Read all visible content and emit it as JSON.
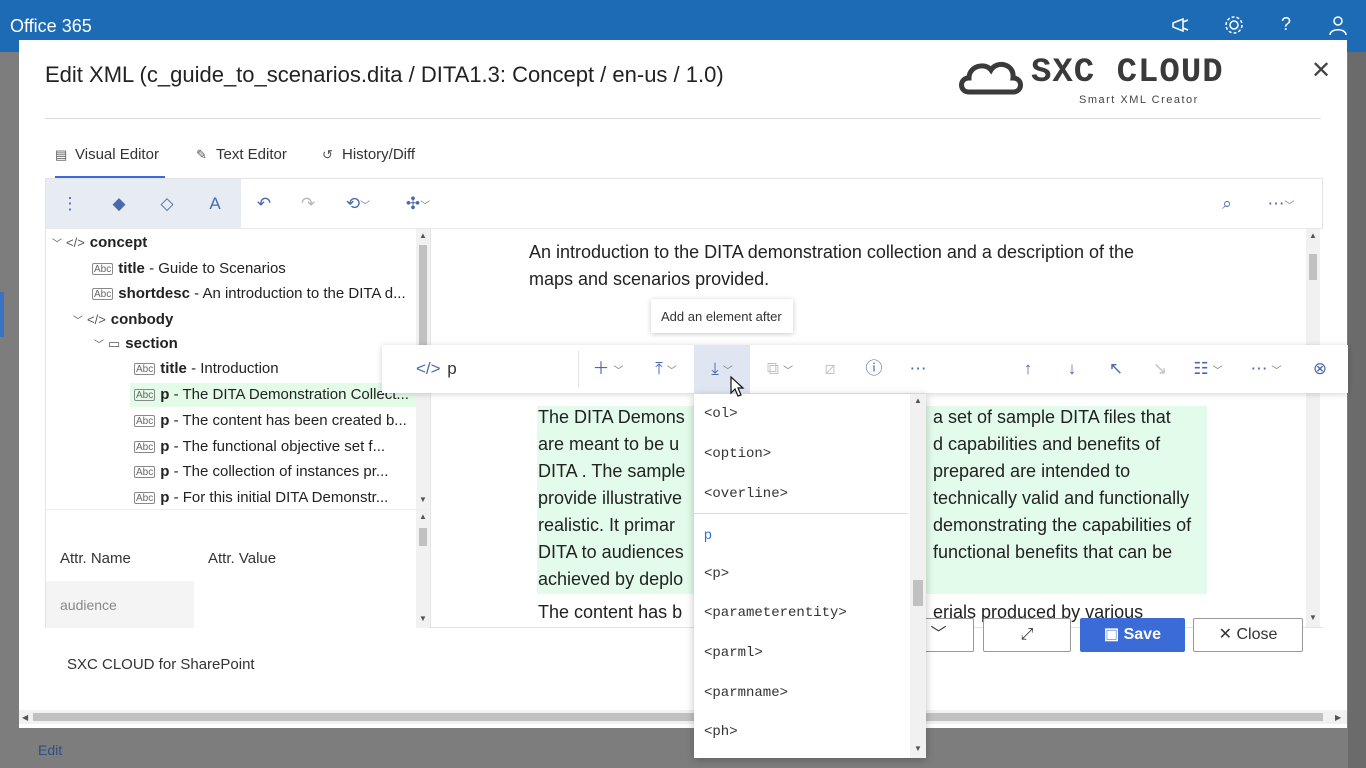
{
  "topbar": {
    "brand": "Office 365",
    "icons": [
      "megaphone-icon",
      "gear-icon",
      "help-icon",
      "person-icon"
    ]
  },
  "background": {
    "edit_link": "Edit"
  },
  "modal": {
    "title": "Edit XML (c_guide_to_scenarios.dita / DITA1.3: Concept / en-us / 1.0)",
    "logo_word": "SXC CLOUD",
    "logo_tagline": "Smart XML Creator",
    "close_symbol": "✕"
  },
  "tabs": [
    {
      "label": "Visual Editor",
      "icon": "visual-editor-icon",
      "active": true
    },
    {
      "label": "Text Editor",
      "icon": "pencil-icon",
      "active": false
    },
    {
      "label": "History/Diff",
      "icon": "history-icon",
      "active": false
    }
  ],
  "tree": [
    {
      "tag": "concept",
      "text": "",
      "kind": "element",
      "expanded": true
    },
    {
      "tag": "title",
      "text": " - Guide to Scenarios",
      "kind": "text"
    },
    {
      "tag": "shortdesc",
      "text": " - An introduction to the DITA d...",
      "kind": "text"
    },
    {
      "tag": "conbody",
      "text": "",
      "kind": "element",
      "expanded": true
    },
    {
      "tag": "section",
      "text": "",
      "kind": "section",
      "expanded": true
    },
    {
      "tag": "title",
      "text": " - Introduction",
      "kind": "text"
    },
    {
      "tag": "p",
      "text": " - The DITA Demonstration Collect...",
      "kind": "text",
      "selected": true
    },
    {
      "tag": "p",
      "text": " - The content has been created b...",
      "kind": "text"
    },
    {
      "tag": "p",
      "text": " - The functional objective set f...",
      "kind": "text"
    },
    {
      "tag": "p",
      "text": " - The collection of instances pr...",
      "kind": "text"
    },
    {
      "tag": "p",
      "text": " - For this initial DITA Demonstr...",
      "kind": "text"
    }
  ],
  "attributes": {
    "name_header": "Attr. Name",
    "value_header": "Attr. Value",
    "rows": [
      {
        "name": "audience",
        "value": ""
      }
    ]
  },
  "document": {
    "shortdesc_line1": "An introduction to the DITA demonstration collection and a description of the",
    "shortdesc_line2": "maps and scenarios provided.",
    "p1_lines": [
      "The DITA Demons",
      "are meant to be u",
      "DITA . The sample",
      "provide illustrative",
      "realistic. It primar",
      "DITA to audiences",
      "achieved by deplo"
    ],
    "p1_right_lines": [
      "a set of sample DITA files that",
      "d capabilities and benefits of",
      "prepared are intended to",
      "technically valid and functionally",
      "demonstrating the capabilities of",
      "functional benefits that can be",
      ""
    ],
    "p2_left": "The content has b",
    "p2_right": "erials produced by various"
  },
  "float_toolbar": {
    "element_name": "p",
    "tooltip": "Add an element after"
  },
  "dropdown": {
    "items": [
      "<ol>",
      "<option>",
      "<overline>",
      "p",
      "<p>",
      "<parameterentity>",
      "<parml>",
      "<parmname>",
      "<ph>"
    ],
    "selected_index": 3
  },
  "footer": {
    "label": "SXC CLOUD for SharePoint",
    "save": "Save",
    "close": "Close"
  },
  "colors": {
    "accent": "#3b6bd6",
    "highlight": "#e3fbea",
    "office_bar": "#1d6bb5"
  }
}
